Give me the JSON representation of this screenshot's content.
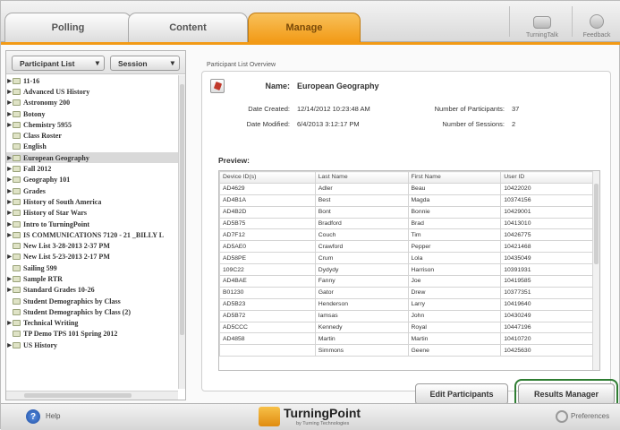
{
  "tabs": [
    {
      "label": "Polling",
      "active": false
    },
    {
      "label": "Content",
      "active": false
    },
    {
      "label": "Manage",
      "active": true
    }
  ],
  "top_buttons": {
    "turningtalk": "TurningTalk",
    "feedback": "Feedback"
  },
  "left_panel": {
    "participant_list_dropdown": "Participant List",
    "session_dropdown": "Session",
    "items": [
      {
        "label": "11-16",
        "expandable": true
      },
      {
        "label": "Advanced US History",
        "expandable": true
      },
      {
        "label": "Astronomy 200",
        "expandable": true
      },
      {
        "label": "Botony",
        "expandable": true
      },
      {
        "label": "Chemistry 5955",
        "expandable": true
      },
      {
        "label": "Class Roster",
        "expandable": false
      },
      {
        "label": "English",
        "expandable": false
      },
      {
        "label": "European Geography",
        "expandable": true,
        "selected": true
      },
      {
        "label": "Fall 2012",
        "expandable": true
      },
      {
        "label": "Geography 101",
        "expandable": true
      },
      {
        "label": "Grades",
        "expandable": true
      },
      {
        "label": "History of South America",
        "expandable": true
      },
      {
        "label": "History of Star Wars",
        "expandable": true
      },
      {
        "label": "Intro to TurningPoint",
        "expandable": true
      },
      {
        "label": "IS COMMUNICATIONS 7120 - 21 _BILLY L",
        "expandable": true
      },
      {
        "label": "New List 3-28-2013 2-37 PM",
        "expandable": false
      },
      {
        "label": "New List 5-23-2013 2-17 PM",
        "expandable": true
      },
      {
        "label": "Sailing 599",
        "expandable": false
      },
      {
        "label": "Sample RTR",
        "expandable": true
      },
      {
        "label": "Standard Grades 10-26",
        "expandable": true
      },
      {
        "label": "Student Demographics by Class",
        "expandable": false
      },
      {
        "label": "Student Demographics by Class (2)",
        "expandable": false
      },
      {
        "label": "Technical Writing",
        "expandable": true
      },
      {
        "label": "TP Demo TPS 101 Spring 2012",
        "expandable": false
      },
      {
        "label": "US History",
        "expandable": true
      }
    ]
  },
  "overview": {
    "section_title": "Participant List Overview",
    "name_label": "Name:",
    "name_value": "European Geography",
    "date_created_label": "Date Created:",
    "date_created_value": "12/14/2012 10:23:48 AM",
    "date_modified_label": "Date Modified:",
    "date_modified_value": "6/4/2013 3:12:17 PM",
    "num_participants_label": "Number of Participants:",
    "num_participants_value": "37",
    "num_sessions_label": "Number of Sessions:",
    "num_sessions_value": "2",
    "preview_label": "Preview:"
  },
  "table": {
    "headers": [
      "Device ID(s)",
      "Last Name",
      "First Name",
      "User ID"
    ],
    "rows": [
      [
        "AD4629",
        "Adler",
        "Beau",
        "10422020"
      ],
      [
        "AD4B1A",
        "Best",
        "Magda",
        "10374156"
      ],
      [
        "AD4B2D",
        "Bont",
        "Bonnie",
        "10429001"
      ],
      [
        "AD5B75",
        "Bradford",
        "Brad",
        "10413010"
      ],
      [
        "AD7F12",
        "Couch",
        "Tim",
        "10426775"
      ],
      [
        "AD5AE0",
        "Crawford",
        "Pepper",
        "10421468"
      ],
      [
        "AD58PE",
        "Crum",
        "Lola",
        "10435049"
      ],
      [
        "109C22",
        "Dydydy",
        "Harrison",
        "10391931"
      ],
      [
        "AD4BAE",
        "Fanny",
        "Joe",
        "10419585"
      ],
      [
        "B01230",
        "Gator",
        "Drew",
        "10377351"
      ],
      [
        "AD5B23",
        "Henderson",
        "Larry",
        "10419640"
      ],
      [
        "AD5B72",
        "Iamsas",
        "John",
        "10430249"
      ],
      [
        "AD5CCC",
        "Kennedy",
        "Royal",
        "10447196"
      ],
      [
        "AD4858",
        "Martin",
        "Martin",
        "10410720"
      ],
      [
        "",
        "Simmons",
        "Geene",
        "10425630"
      ]
    ]
  },
  "buttons": {
    "edit_participants": "Edit Participants",
    "results_manager": "Results Manager"
  },
  "footer": {
    "help": "Help",
    "brand": "TurningPoint",
    "brand_sub": "by Turning Technologies",
    "preferences": "Preferences"
  },
  "colors": {
    "accent": "#f29a16",
    "highlight_ring": "#2e7d32"
  }
}
